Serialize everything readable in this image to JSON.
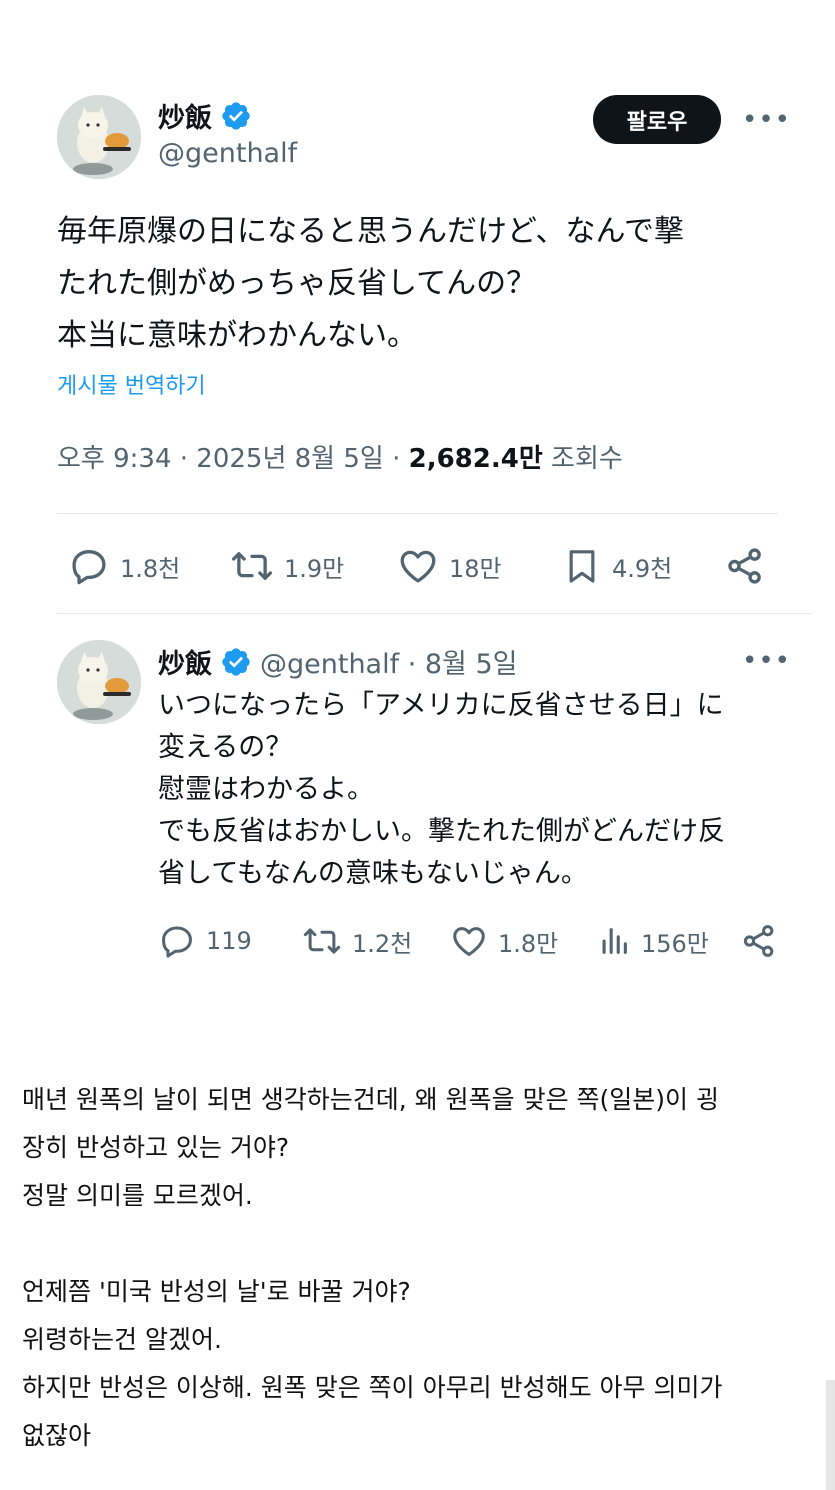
{
  "main_tweet": {
    "author_name": "炒飯",
    "author_handle": "@genthalf",
    "follow_label": "팔로우",
    "more_label": "•••",
    "text": "毎年原爆の日になると思うんだけど、なんで撃\nたれた側がめっちゃ反省してんの？\n本当に意味がわかんない。",
    "translate_label": "게시물 번역하기",
    "meta_time_date": "오후 9:34 · 2025년 8월 5일 · ",
    "meta_views_count": "2,682.4만",
    "meta_views_label": " 조회수",
    "replies": "1.8천",
    "reposts": "1.9만",
    "likes": "18만",
    "bookmarks": "4.9천"
  },
  "reply_tweet": {
    "author_name": "炒飯",
    "author_handle_date": "@genthalf · 8월 5일",
    "more_label": "•••",
    "text": "いつになったら「アメリカに反省させる日」に\n変えるの？\n慰霊はわかるよ。\nでも反省はおかしい。撃たれた側がどんだけ反\n省してもなんの意味もないじゃん。",
    "replies": "119",
    "reposts": "1.2천",
    "likes": "1.8만",
    "views": "156만"
  },
  "translation": {
    "text": "매년 원폭의 날이 되면 생각하는건데, 왜 원폭을 맞은 쪽(일본)이 굉\n장히 반성하고 있는 거야?\n정말 의미를 모르겠어.\n\n언제쯤 '미국 반성의 날'로 바꿀 거야?\n위령하는건 알겠어.\n하지만 반성은 이상해. 원폭 맞은 쪽이 아무리 반성해도 아무 의미가\n없잖아"
  },
  "colors": {
    "accent": "#1d9bf0",
    "text": "#0f1419",
    "secondary": "#536471",
    "button_bg": "#0f1419"
  },
  "icons": [
    "verified-badge-icon",
    "more-icon",
    "reply-icon",
    "repost-icon",
    "like-icon",
    "bookmark-icon",
    "share-icon",
    "views-icon"
  ]
}
